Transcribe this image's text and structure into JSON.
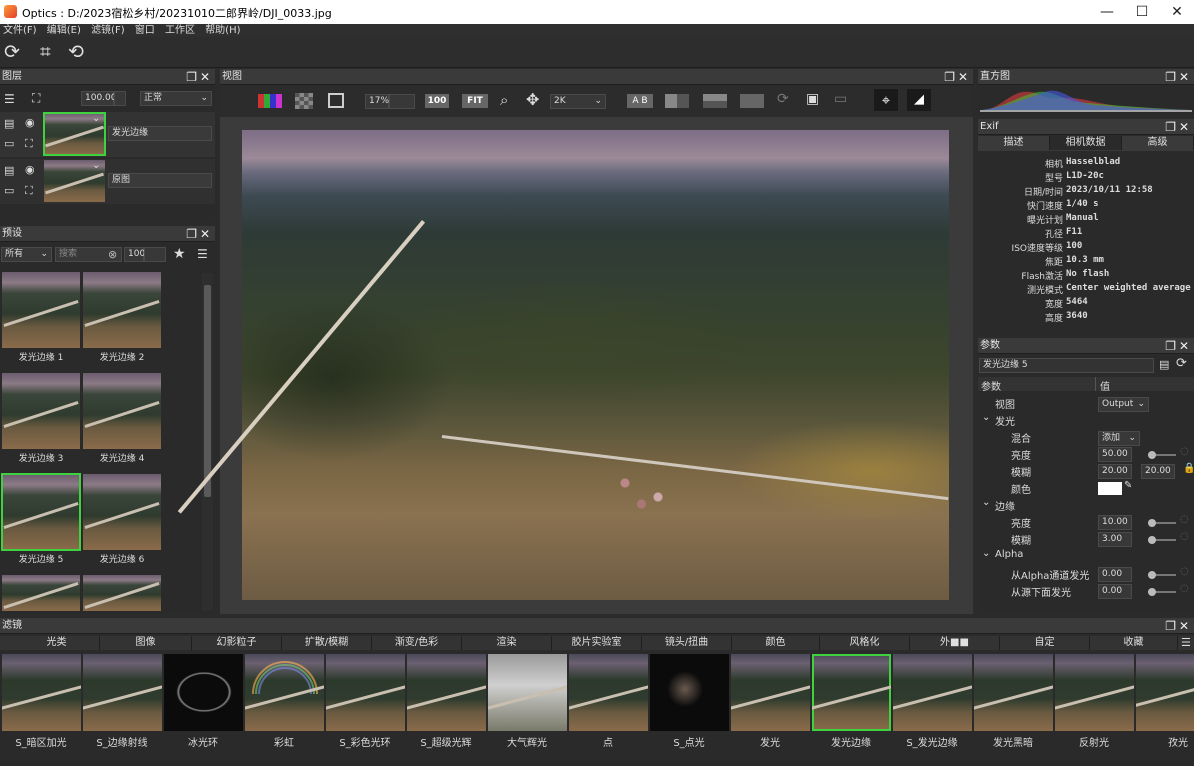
{
  "window": {
    "title": "Optics : D:/2023宿松乡村/20231010二郎界岭/DJI_0033.jpg",
    "min": "—",
    "max": "☐",
    "close": "✕"
  },
  "menu": [
    "文件(F)",
    "编辑(E)",
    "滤镜(F)",
    "窗口",
    "工作区",
    "帮助(H)"
  ],
  "layers": {
    "title": "图层",
    "opacity": "100.00",
    "blend": "正常",
    "items": [
      {
        "name": "发光边缘"
      },
      {
        "name": "原图"
      }
    ]
  },
  "presets": {
    "title": "预设",
    "filter": "所有",
    "search_placeholder": "搜索",
    "count": "100",
    "items": [
      "发光边缘 1",
      "发光边缘 2",
      "发光边缘 3",
      "发光边缘 4",
      "发光边缘 5",
      "发光边缘 6"
    ]
  },
  "view": {
    "title": "视图",
    "zoom": "17%",
    "zoom_100": "100",
    "fit": "FIT",
    "size": "2K",
    "ab": "A B"
  },
  "histogram": {
    "title": "直方图"
  },
  "exif": {
    "title": "Exif",
    "tabs": [
      "描述",
      "相机数据",
      "高级"
    ],
    "rows": [
      {
        "k": "相机",
        "v": "Hasselblad"
      },
      {
        "k": "型号",
        "v": "L1D-20c"
      },
      {
        "k": "日期/时间",
        "v": "2023/10/11 12:58"
      },
      {
        "k": "快门速度",
        "v": "1/40 s"
      },
      {
        "k": "曝光计划",
        "v": "Manual"
      },
      {
        "k": "孔径",
        "v": "F11"
      },
      {
        "k": "ISO速度等级",
        "v": "100"
      },
      {
        "k": "焦距",
        "v": "10.3 mm"
      },
      {
        "k": "Flash激活",
        "v": "No flash"
      },
      {
        "k": "测光模式",
        "v": "Center weighted average"
      },
      {
        "k": "宽度",
        "v": "5464"
      },
      {
        "k": "高度",
        "v": "3640"
      }
    ]
  },
  "params": {
    "title": "参数",
    "preset": "发光边缘 5",
    "col_param": "参数",
    "col_value": "值",
    "view_label": "视图",
    "view_value": "Output",
    "glow_group": "发光",
    "blend_label": "混合",
    "blend_value": "添加",
    "brightness_label": "亮度",
    "brightness_value": "50.00",
    "blur_label": "模糊",
    "blur_x": "20.00",
    "blur_y": "20.00",
    "color_label": "颜色",
    "edge_group": "边缘",
    "edge_brightness_label": "亮度",
    "edge_brightness_value": "10.00",
    "edge_blur_label": "模糊",
    "edge_blur_value": "3.00",
    "alpha_group": "Alpha",
    "alpha_glow_label": "从Alpha通道发光",
    "alpha_glow_value": "0.00",
    "below_glow_label": "从源下面发光",
    "below_glow_value": "0.00"
  },
  "filters": {
    "title": "滤镜",
    "tabs": [
      "光类",
      "图像",
      "幻影粒子",
      "扩散/模糊",
      "渐变/色彩",
      "渲染",
      "胶片实验室",
      "镜头/扭曲",
      "颜色",
      "风格化",
      "外■■",
      "自定",
      "收藏"
    ],
    "items": [
      "S_暗区加光",
      "S_边缘射线",
      "冰光环",
      "彩虹",
      "S_彩色光环",
      "S_超级光辉",
      "大气辉光",
      "点",
      "S_点光",
      "发光",
      "发光边缘",
      "S_发光边缘",
      "发光黑暗",
      "反射光",
      "孜光"
    ]
  }
}
